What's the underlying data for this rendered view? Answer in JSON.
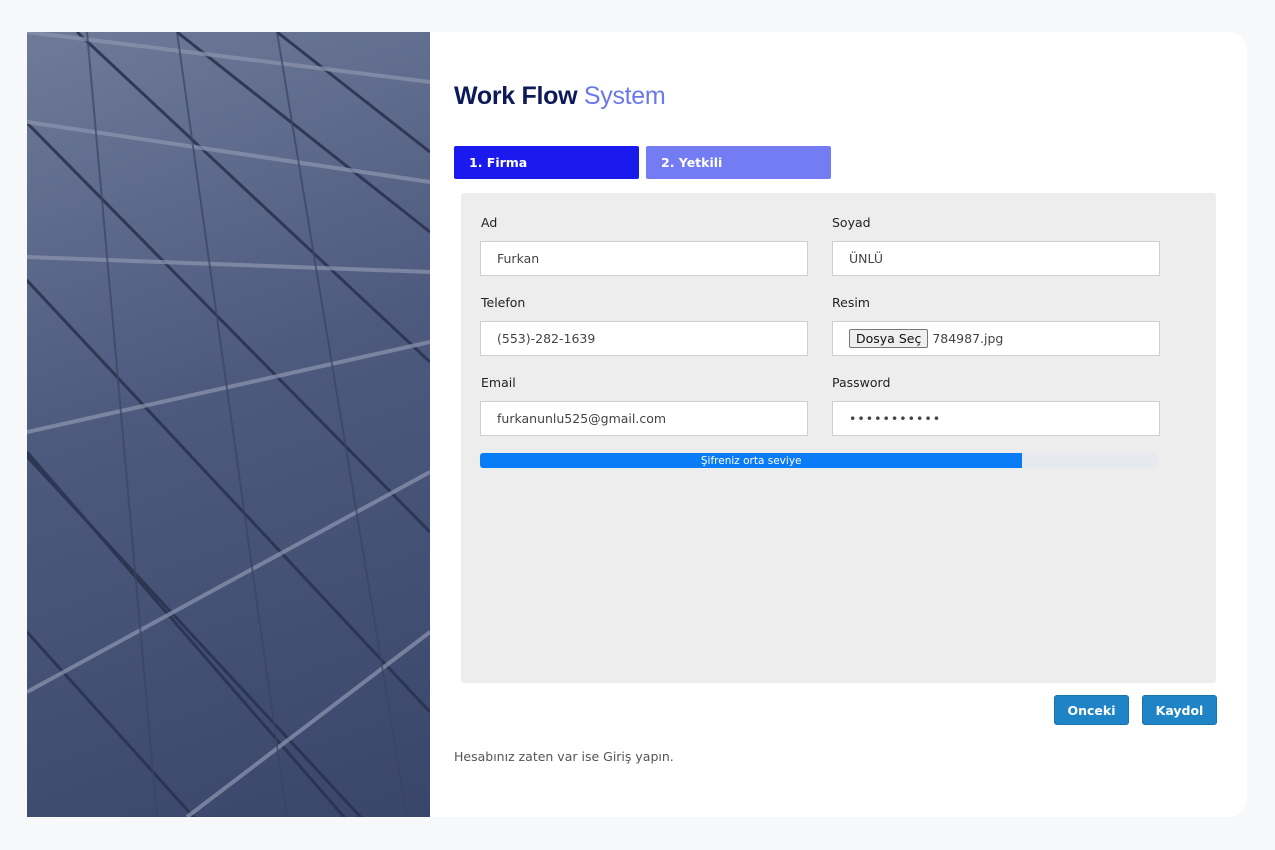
{
  "header": {
    "title_strong": "Work Flow",
    "title_light": "System"
  },
  "steps": [
    {
      "label": "1. Firma"
    },
    {
      "label": "2. Yetkili"
    }
  ],
  "form": {
    "first_name": {
      "label": "Ad",
      "value": "Furkan"
    },
    "last_name": {
      "label": "Soyad",
      "value": "ÜNLÜ"
    },
    "phone": {
      "label": "Telefon",
      "value": "(553)-282-1639"
    },
    "image": {
      "label": "Resim",
      "button_label": "Dosya Seç",
      "file_name": "784987.jpg"
    },
    "email": {
      "label": "Email",
      "value": "furkanunlu525@gmail.com"
    },
    "password": {
      "label": "Password",
      "masked_value": "•••••••••••"
    },
    "strength": {
      "text": "Şifreniz orta seviye",
      "percent": 80
    }
  },
  "actions": {
    "prev_label": "Onceki",
    "submit_label": "Kaydol"
  },
  "footer": {
    "login_hint": "Hesabınız zaten var ise Giriş yapın."
  },
  "colors": {
    "step_active": "#1a1aee",
    "step_inactive": "#737cf2",
    "progress": "#0a7cf5",
    "button": "#1f84c6",
    "title_dark": "#0c1a5a",
    "title_light": "#6b78e8"
  }
}
